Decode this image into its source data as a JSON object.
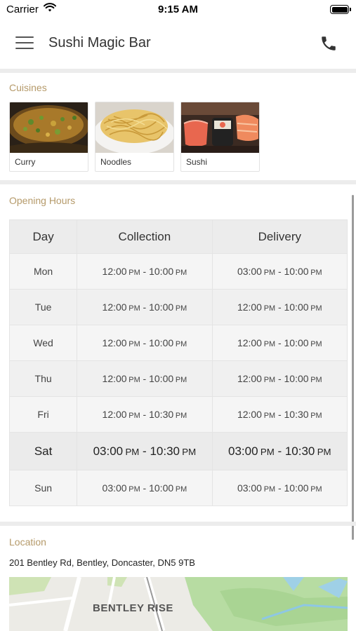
{
  "status_bar": {
    "carrier": "Carrier",
    "time": "9:15 AM"
  },
  "header": {
    "title": "Sushi Magic Bar",
    "menu_icon": "hamburger-menu-icon",
    "phone_icon": "phone-icon"
  },
  "cuisines": {
    "label": "Cuisines",
    "items": [
      {
        "name": "Curry"
      },
      {
        "name": "Noodles"
      },
      {
        "name": "Sushi"
      }
    ]
  },
  "opening_hours": {
    "label": "Opening Hours",
    "headers": [
      "Day",
      "Collection",
      "Delivery"
    ],
    "rows": [
      {
        "day": "Mon",
        "collection_start": "12:00",
        "collection_end": "10:00",
        "delivery_start": "03:00",
        "delivery_end": "10:00"
      },
      {
        "day": "Tue",
        "collection_start": "12:00",
        "collection_end": "10:00",
        "delivery_start": "12:00",
        "delivery_end": "10:00"
      },
      {
        "day": "Wed",
        "collection_start": "12:00",
        "collection_end": "10:00",
        "delivery_start": "12:00",
        "delivery_end": "10:00"
      },
      {
        "day": "Thu",
        "collection_start": "12:00",
        "collection_end": "10:00",
        "delivery_start": "12:00",
        "delivery_end": "10:00"
      },
      {
        "day": "Fri",
        "collection_start": "12:00",
        "collection_end": "10:30",
        "delivery_start": "12:00",
        "delivery_end": "10:30"
      },
      {
        "day": "Sat",
        "collection_start": "03:00",
        "collection_end": "10:30",
        "delivery_start": "03:00",
        "delivery_end": "10:30",
        "today": true
      },
      {
        "day": "Sun",
        "collection_start": "03:00",
        "collection_end": "10:00",
        "delivery_start": "03:00",
        "delivery_end": "10:00"
      }
    ],
    "ampm": "PM",
    "separator": " - "
  },
  "location": {
    "label": "Location",
    "address": "201 Bentley Rd, Bentley, Doncaster, DN5 9TB",
    "map_label": "BENTLEY RISE"
  },
  "colors": {
    "section_label": "#b59a6a",
    "separator": "#ececec"
  }
}
